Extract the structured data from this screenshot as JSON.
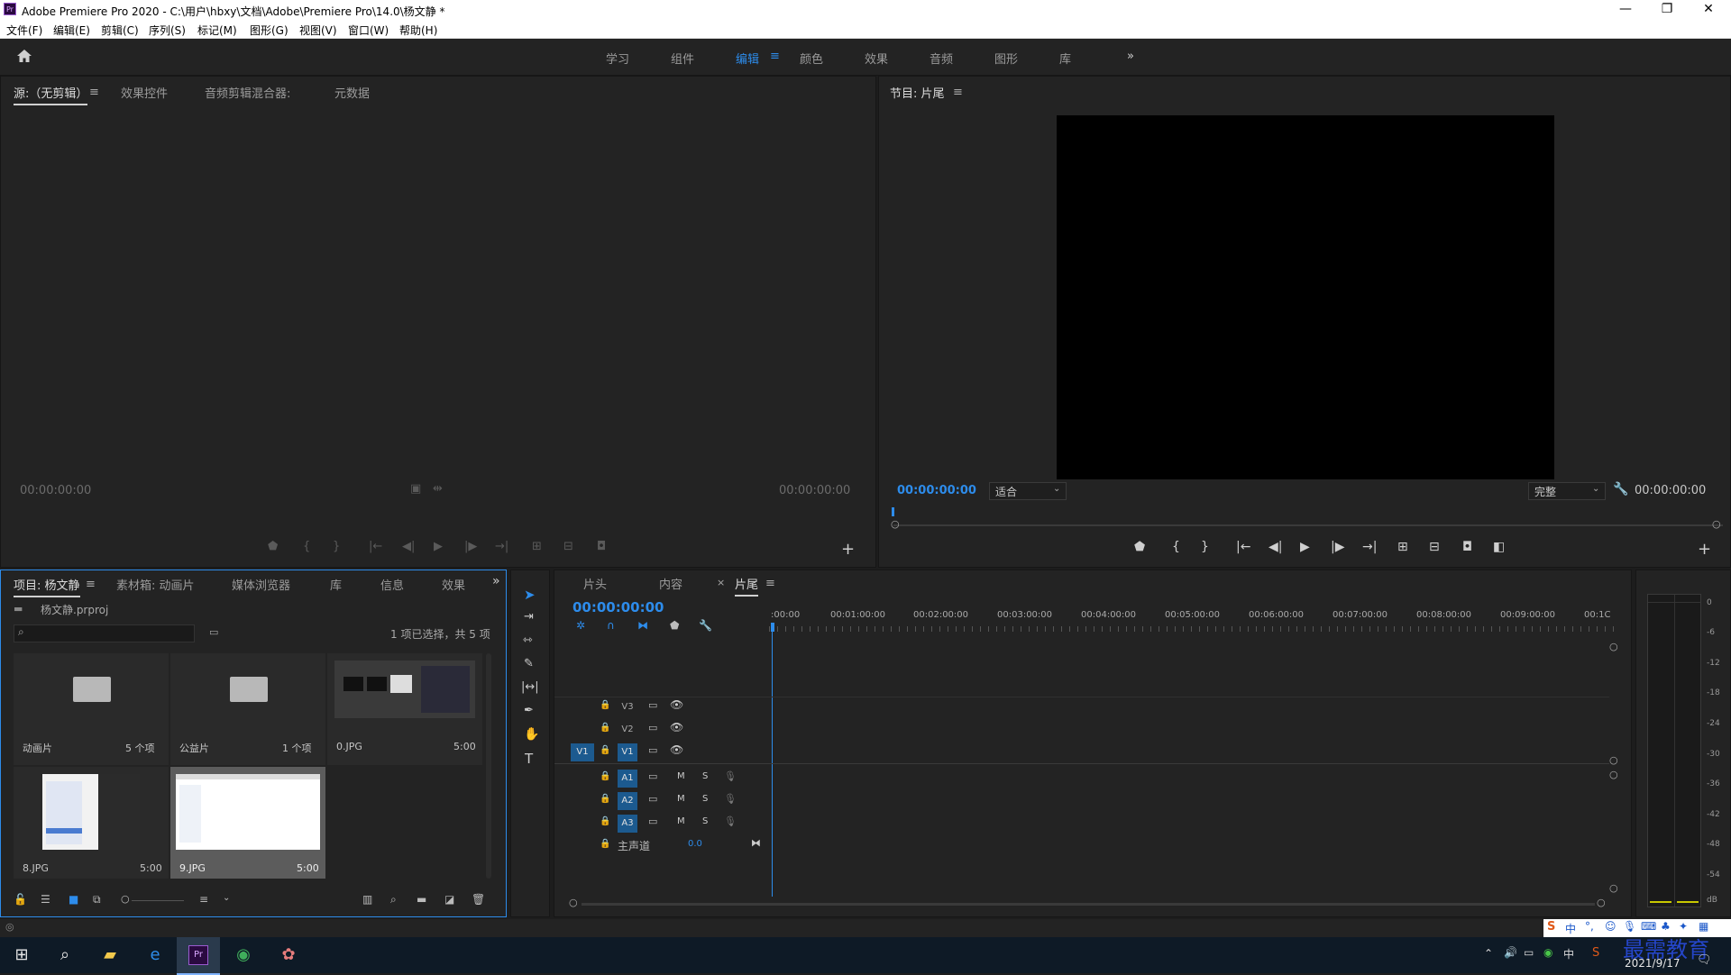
{
  "window": {
    "title": "Adobe Premiere Pro 2020 - C:\\用户\\hbxy\\文档\\Adobe\\Premiere Pro\\14.0\\杨文静 *",
    "logo_text": "Pr",
    "minimize": "—",
    "restore": "❐",
    "close": "✕"
  },
  "menu": [
    "文件(F)",
    "编辑(E)",
    "剪辑(C)",
    "序列(S)",
    "标记(M)",
    "图形(G)",
    "视图(V)",
    "窗口(W)",
    "帮助(H)"
  ],
  "workspaces": {
    "items": [
      "学习",
      "组件",
      "编辑",
      "颜色",
      "效果",
      "音频",
      "图形",
      "库"
    ],
    "active_index": 2,
    "more": "»"
  },
  "source_panel": {
    "tabs": [
      "源:（无剪辑）",
      "效果控件",
      "音频剪辑混合器:",
      "元数据"
    ],
    "left_tc": "00:00:00:00",
    "right_tc": "00:00:00:00"
  },
  "program_panel": {
    "tab": "节目: 片尾",
    "tc_left": "00:00:00:00",
    "zoom": "适合",
    "quality": "完整",
    "tc_right": "00:00:00:00"
  },
  "project_panel": {
    "tabs": [
      "项目: 杨文静",
      "素材箱: 动画片",
      "媒体浏览器",
      "库",
      "信息",
      "效果"
    ],
    "file": "杨文静.prproj",
    "selection_info": "1 项已选择，共 5 项",
    "items": [
      {
        "name": "动画片",
        "meta": "5 个项"
      },
      {
        "name": "公益片",
        "meta": "1 个项"
      },
      {
        "name": "0.JPG",
        "meta": "5:00"
      },
      {
        "name": "8.JPG",
        "meta": "5:00"
      },
      {
        "name": "9.JPG",
        "meta": "5:00"
      }
    ]
  },
  "timeline": {
    "tabs": [
      "片头",
      "内容",
      "片尾"
    ],
    "tab_close": "×",
    "timecode": "00:00:00:00",
    "ruler": [
      ":00:00",
      "00:01:00:00",
      "00:02:00:00",
      "00:03:00:00",
      "00:04:00:00",
      "00:05:00:00",
      "00:06:00:00",
      "00:07:00:00",
      "00:08:00:00",
      "00:09:00:00",
      "00:1C"
    ],
    "video_tracks": [
      "V3",
      "V2",
      "V1"
    ],
    "source_patch": "V1",
    "audio_tracks": [
      "A1",
      "A2",
      "A3"
    ],
    "mute_label": "M",
    "solo_label": "S",
    "master_label": "主声道",
    "master_value": "0.0"
  },
  "audio_meter": {
    "labels": [
      "0",
      "-6",
      "-12",
      "-18",
      "-24",
      "-30",
      "-36",
      "-42",
      "-48",
      "-54",
      "dB"
    ]
  },
  "taskbar": {
    "date": "2021/9/17",
    "watermark": "最需教育",
    "ime": "中"
  }
}
